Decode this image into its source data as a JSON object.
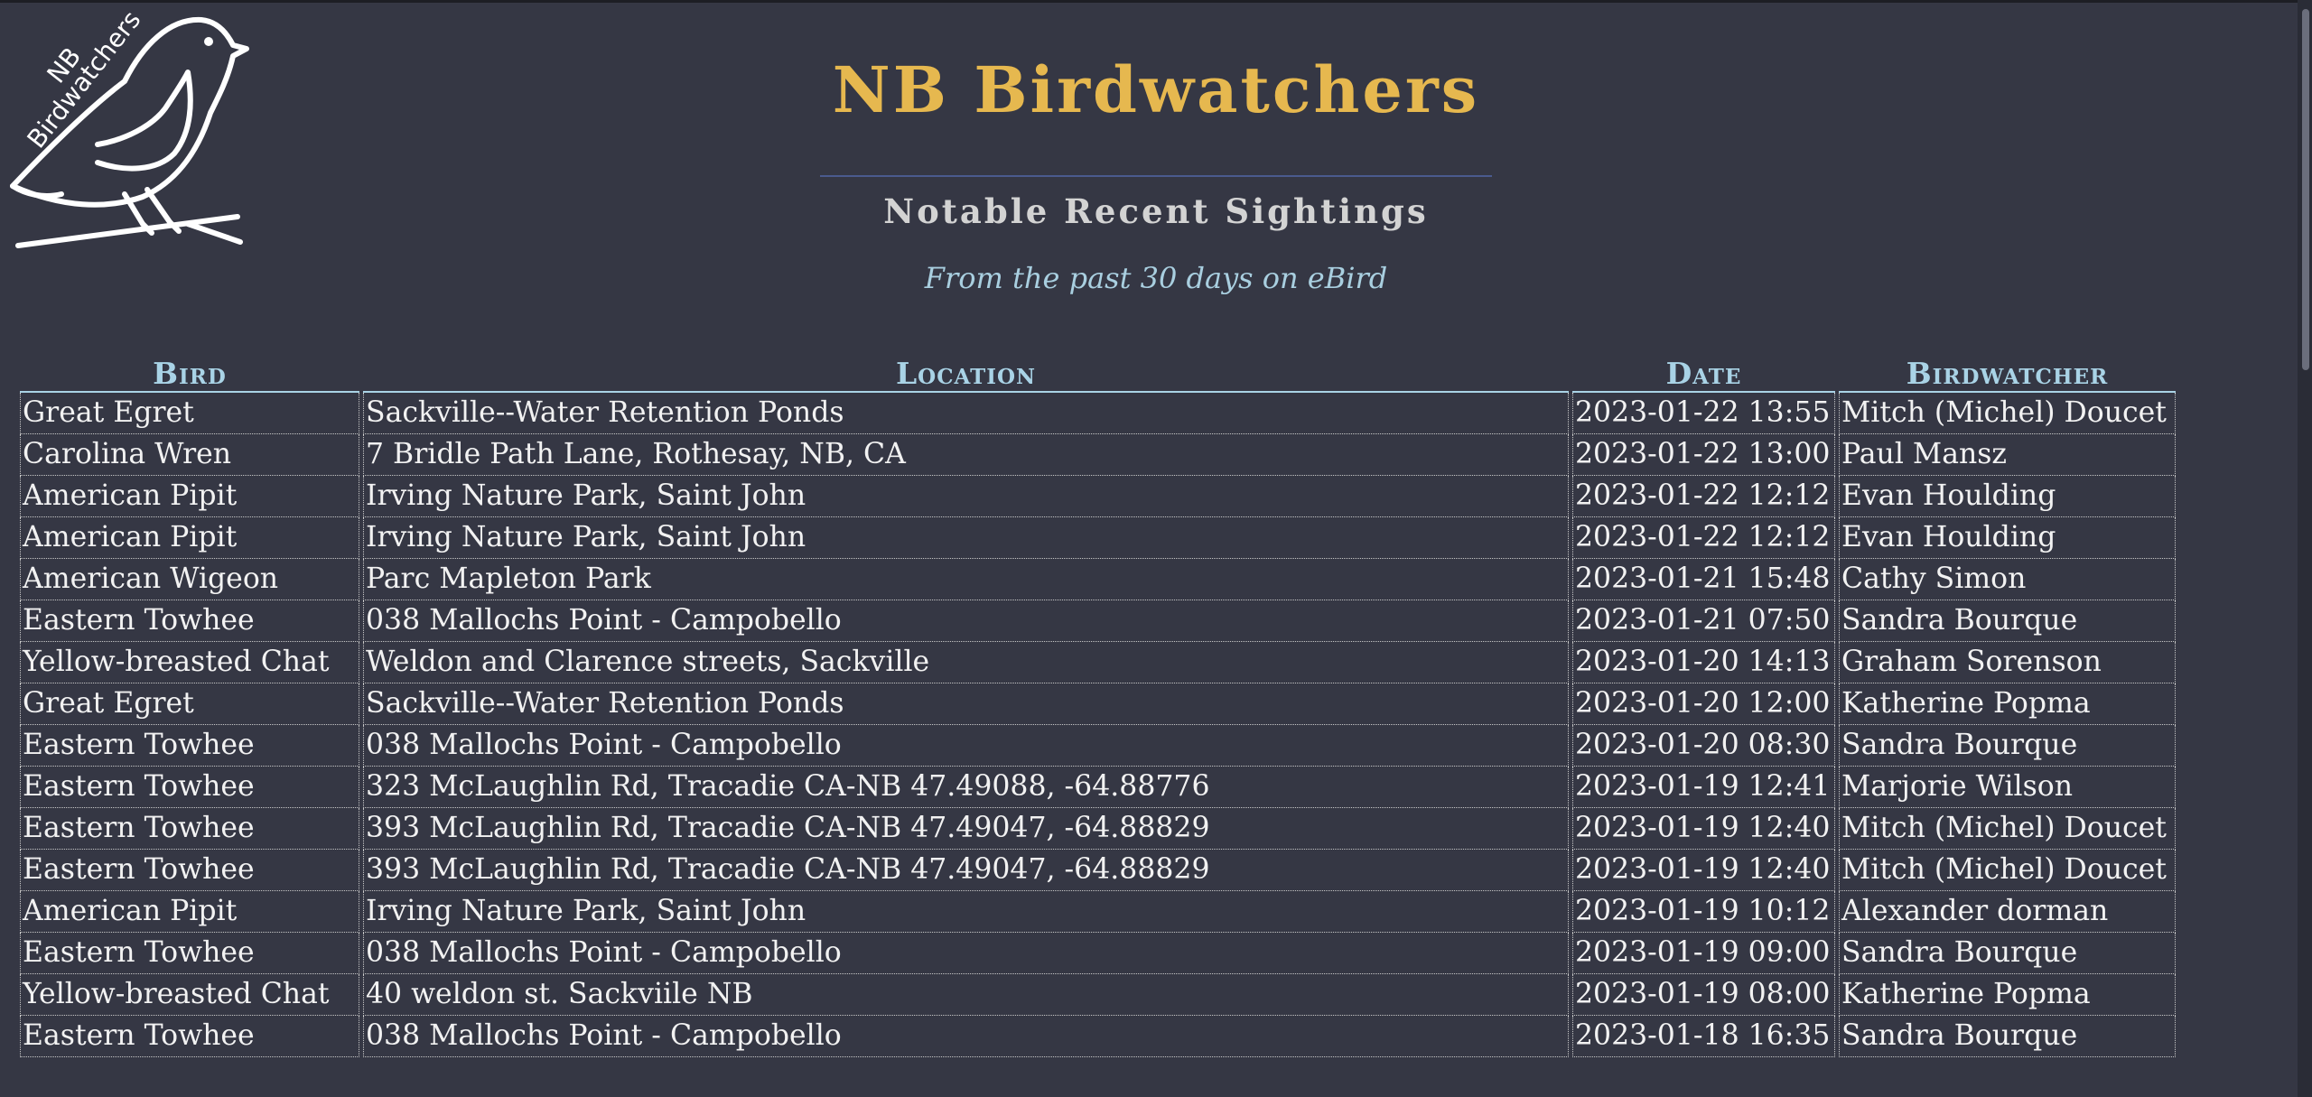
{
  "logo": {
    "text_line1": "NB",
    "text_line2": "Birdwatchers"
  },
  "header": {
    "title": "NB Birdwatchers",
    "subtitle": "Notable Recent Sightings",
    "tagline": "From the past 30 days on eBird"
  },
  "table": {
    "headers": [
      "Bird",
      "Location",
      "Date",
      "Birdwatcher"
    ],
    "rows": [
      [
        "Great Egret",
        "Sackville--Water Retention Ponds",
        "2023-01-22 13:55",
        "Mitch (Michel) Doucet"
      ],
      [
        "Carolina Wren",
        "7 Bridle Path Lane, Rothesay, NB, CA",
        "2023-01-22 13:00",
        "Paul Mansz"
      ],
      [
        "American Pipit",
        "Irving Nature Park, Saint John",
        "2023-01-22 12:12",
        "Evan Houlding"
      ],
      [
        "American Pipit",
        "Irving Nature Park, Saint John",
        "2023-01-22 12:12",
        "Evan Houlding"
      ],
      [
        "American Wigeon",
        "Parc Mapleton Park",
        "2023-01-21 15:48",
        "Cathy Simon"
      ],
      [
        "Eastern Towhee",
        "038 Mallochs Point - Campobello",
        "2023-01-21 07:50",
        "Sandra Bourque"
      ],
      [
        "Yellow-breasted Chat",
        "Weldon and Clarence streets, Sackville",
        "2023-01-20 14:13",
        "Graham Sorenson"
      ],
      [
        "Great Egret",
        "Sackville--Water Retention Ponds",
        "2023-01-20 12:00",
        "Katherine Popma"
      ],
      [
        "Eastern Towhee",
        "038 Mallochs Point - Campobello",
        "2023-01-20 08:30",
        "Sandra Bourque"
      ],
      [
        "Eastern Towhee",
        "323 McLaughlin Rd, Tracadie CA-NB 47.49088, -64.88776",
        "2023-01-19 12:41",
        "Marjorie Wilson"
      ],
      [
        "Eastern Towhee",
        "393 McLaughlin Rd, Tracadie CA-NB 47.49047, -64.88829",
        "2023-01-19 12:40",
        "Mitch (Michel) Doucet"
      ],
      [
        "Eastern Towhee",
        "393 McLaughlin Rd, Tracadie CA-NB 47.49047, -64.88829",
        "2023-01-19 12:40",
        "Mitch (Michel) Doucet"
      ],
      [
        "American Pipit",
        "Irving Nature Park, Saint John",
        "2023-01-19 10:12",
        "Alexander dorman"
      ],
      [
        "Eastern Towhee",
        "038 Mallochs Point - Campobello",
        "2023-01-19 09:00",
        "Sandra Bourque"
      ],
      [
        "Yellow-breasted Chat",
        "40 weldon st. Sackviile NB",
        "2023-01-19 08:00",
        "Katherine Popma"
      ],
      [
        "Eastern Towhee",
        "038 Mallochs Point - Campobello",
        "2023-01-18 16:35",
        "Sandra Bourque"
      ]
    ]
  },
  "colors": {
    "background": "#353744",
    "title": "#e6b84f",
    "header": "#a9d3e6",
    "text": "#f2f2f2"
  }
}
